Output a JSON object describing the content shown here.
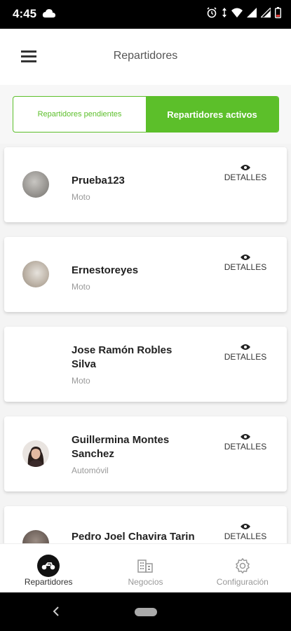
{
  "status_bar": {
    "time": "4:45"
  },
  "appbar": {
    "title": "Repartidores"
  },
  "tabs": [
    {
      "label": "Repartidores pendientes",
      "active": false
    },
    {
      "label": "Repartidores activos",
      "active": true
    }
  ],
  "drivers": [
    {
      "name": "Prueba123",
      "vehicle": "Moto",
      "details_label": "DETALLES",
      "avatar": "photo-gray-icon"
    },
    {
      "name": "Ernestoreyes",
      "vehicle": "Moto",
      "details_label": "DETALLES",
      "avatar": "photo-beige-icon"
    },
    {
      "name": "Jose Ramón Robles Silva",
      "vehicle": "Moto",
      "details_label": "DETALLES",
      "avatar": "none"
    },
    {
      "name": "Guillermina Montes Sanchez",
      "vehicle": "Automóvil",
      "details_label": "DETALLES",
      "avatar": "woman-photo-icon"
    },
    {
      "name": "Pedro Joel Chavira Tarin",
      "vehicle": "",
      "details_label": "DETALLES",
      "avatar": "photo-partial-icon"
    }
  ],
  "bottom_nav": [
    {
      "label": "Repartidores",
      "icon": "scooter-icon",
      "active": true
    },
    {
      "label": "Negocios",
      "icon": "building-icon",
      "active": false
    },
    {
      "label": "Configuración",
      "icon": "gear-icon",
      "active": false
    }
  ],
  "colors": {
    "accent": "#5cbf2a",
    "text": "#222222",
    "muted": "#999999"
  }
}
